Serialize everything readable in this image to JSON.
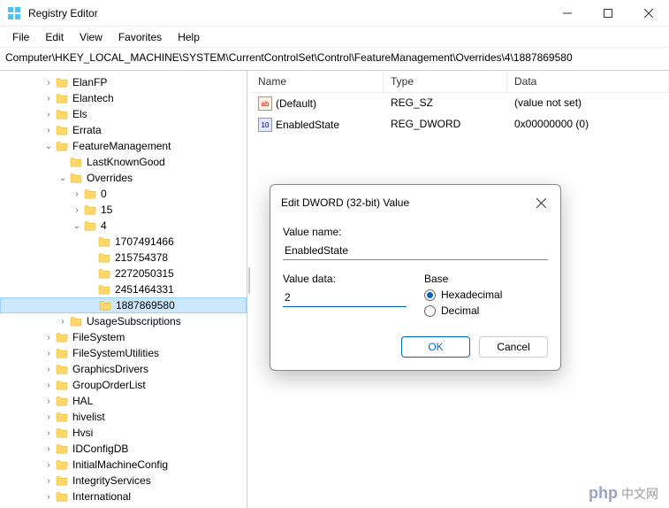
{
  "window": {
    "title": "Registry Editor"
  },
  "menu": {
    "file": "File",
    "edit": "Edit",
    "view": "View",
    "favorites": "Favorites",
    "help": "Help"
  },
  "address": "Computer\\HKEY_LOCAL_MACHINE\\SYSTEM\\CurrentControlSet\\Control\\FeatureManagement\\Overrides\\4\\1887869580",
  "tree": [
    {
      "d": 3,
      "t": ">",
      "l": "ElanFP"
    },
    {
      "d": 3,
      "t": ">",
      "l": "Elantech"
    },
    {
      "d": 3,
      "t": ">",
      "l": "Els"
    },
    {
      "d": 3,
      "t": ">",
      "l": "Errata"
    },
    {
      "d": 3,
      "t": "v",
      "l": "FeatureManagement"
    },
    {
      "d": 4,
      "t": " ",
      "l": "LastKnownGood"
    },
    {
      "d": 4,
      "t": "v",
      "l": "Overrides"
    },
    {
      "d": 5,
      "t": ">",
      "l": "0"
    },
    {
      "d": 5,
      "t": ">",
      "l": "15"
    },
    {
      "d": 5,
      "t": "v",
      "l": "4"
    },
    {
      "d": 6,
      "t": " ",
      "l": "1707491466"
    },
    {
      "d": 6,
      "t": " ",
      "l": "215754378"
    },
    {
      "d": 6,
      "t": " ",
      "l": "2272050315"
    },
    {
      "d": 6,
      "t": " ",
      "l": "2451464331"
    },
    {
      "d": 6,
      "t": " ",
      "l": "1887869580",
      "sel": true
    },
    {
      "d": 4,
      "t": ">",
      "l": "UsageSubscriptions"
    },
    {
      "d": 3,
      "t": ">",
      "l": "FileSystem"
    },
    {
      "d": 3,
      "t": ">",
      "l": "FileSystemUtilities"
    },
    {
      "d": 3,
      "t": ">",
      "l": "GraphicsDrivers"
    },
    {
      "d": 3,
      "t": ">",
      "l": "GroupOrderList"
    },
    {
      "d": 3,
      "t": ">",
      "l": "HAL"
    },
    {
      "d": 3,
      "t": ">",
      "l": "hivelist"
    },
    {
      "d": 3,
      "t": ">",
      "l": "Hvsi"
    },
    {
      "d": 3,
      "t": ">",
      "l": "IDConfigDB"
    },
    {
      "d": 3,
      "t": ">",
      "l": "InitialMachineConfig"
    },
    {
      "d": 3,
      "t": ">",
      "l": "IntegrityServices"
    },
    {
      "d": 3,
      "t": ">",
      "l": "International"
    }
  ],
  "list": {
    "headers": {
      "name": "Name",
      "type": "Type",
      "data": "Data"
    },
    "rows": [
      {
        "icon": "str",
        "name": "(Default)",
        "type": "REG_SZ",
        "data": "(value not set)"
      },
      {
        "icon": "dw",
        "name": "EnabledState",
        "type": "REG_DWORD",
        "data": "0x00000000 (0)"
      }
    ]
  },
  "dialog": {
    "title": "Edit DWORD (32-bit) Value",
    "value_name_label": "Value name:",
    "value_name": "EnabledState",
    "value_data_label": "Value data:",
    "value_data": "2",
    "base_label": "Base",
    "hex": "Hexadecimal",
    "dec": "Decimal",
    "ok": "OK",
    "cancel": "Cancel"
  },
  "watermark": {
    "php": "php",
    "cn": "中文网"
  }
}
